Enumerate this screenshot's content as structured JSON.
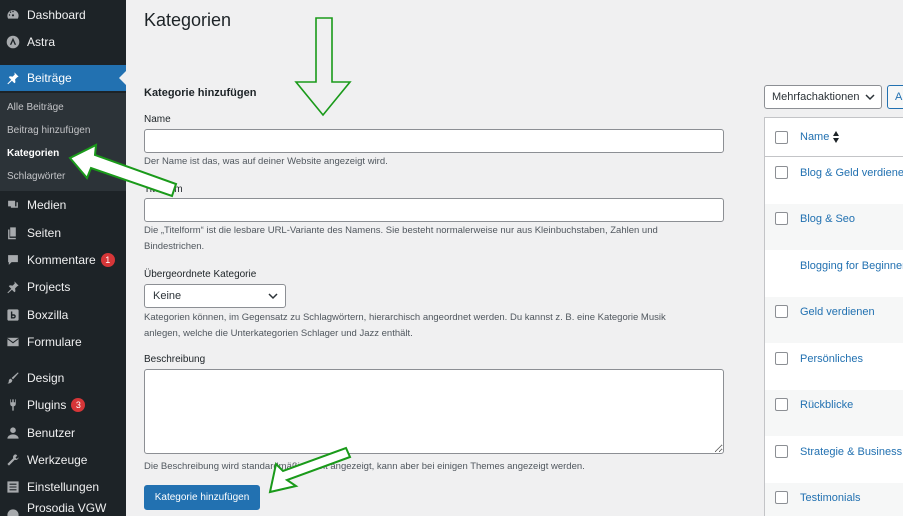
{
  "sidebar": {
    "items": [
      {
        "label": "Dashboard",
        "icon": "dashboard-icon"
      },
      {
        "label": "Astra",
        "icon": "astra-icon"
      },
      {
        "label": "Beiträge",
        "icon": "pin-icon"
      },
      {
        "label": "Medien",
        "icon": "media-icon"
      },
      {
        "label": "Seiten",
        "icon": "pages-icon"
      },
      {
        "label": "Kommentare",
        "icon": "comment-icon",
        "badge": "1"
      },
      {
        "label": "Projects",
        "icon": "pin-icon"
      },
      {
        "label": "Boxzilla",
        "icon": "boxzilla-icon"
      },
      {
        "label": "Formulare",
        "icon": "mail-icon"
      },
      {
        "label": "Design",
        "icon": "brush-icon"
      },
      {
        "label": "Plugins",
        "icon": "plugin-icon",
        "badge": "3"
      },
      {
        "label": "Benutzer",
        "icon": "user-icon"
      },
      {
        "label": "Werkzeuge",
        "icon": "wrench-icon"
      },
      {
        "label": "Einstellungen",
        "icon": "settings-icon"
      },
      {
        "label": "Prosodia VGW OS",
        "icon": "prosodia-icon"
      }
    ],
    "submenu": [
      "Alle Beiträge",
      "Beitrag hinzufügen",
      "Kategorien",
      "Schlagwörter"
    ]
  },
  "main": {
    "title": "Kategorien",
    "form_heading": "Kategorie hinzufügen",
    "name_label": "Name",
    "name_value": "",
    "name_desc": "Der Name ist das, was auf deiner Website angezeigt wird.",
    "slug_label": "Titelform",
    "slug_value": "",
    "slug_desc_1": "Die „Titelform“ ist die lesbare URL-Variante des Namens. Sie besteht normalerweise nur aus Kleinbuchstaben, Zahlen und",
    "slug_desc_2": "Bindestrichen.",
    "parent_label": "Übergeordnete Kategorie",
    "parent_value": "Keine",
    "parent_desc_1": "Kategorien können, im Gegensatz zu Schlagwörtern, hierarchisch angeordnet werden. Du kannst z. B. eine Kategorie Musik",
    "parent_desc_2": "anlegen, welche die Unterkategorien Schlager und Jazz enthält.",
    "description_label": "Beschreibung",
    "description_desc": "Die Beschreibung wird standardmäßig nicht angezeigt, kann aber bei einigen Themes angezeigt werden.",
    "submit_label": "Kategorie hinzufügen"
  },
  "list": {
    "bulk_actions": "Mehrfachaktionen",
    "apply_label": "A",
    "column_name": "Name",
    "rows": [
      "Blog & Geld verdienen",
      "Blog & Seo",
      "Blogging for Beginners",
      "Geld verdienen",
      "Persönliches",
      "Rückblicke",
      "Strategie & Business",
      "Testimonials"
    ]
  },
  "colors": {
    "sidebar_bg": "#1d2327",
    "accent": "#2271b1",
    "annotation_arrow": "#1a9a1a"
  }
}
